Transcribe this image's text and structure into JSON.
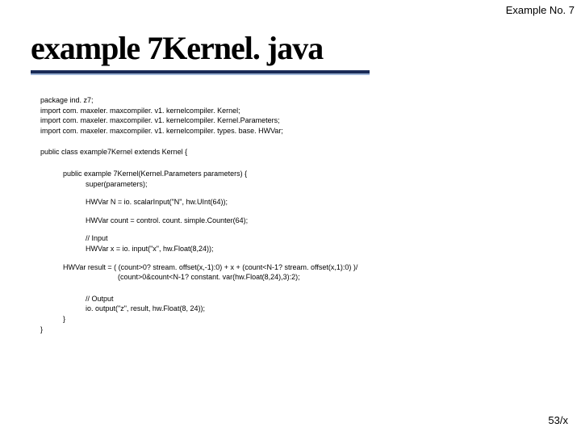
{
  "header": {
    "label": "Example No. 7"
  },
  "title": "example 7Kernel. java",
  "code": {
    "l0": "package ind. z7;",
    "l1": "import com. maxeler. maxcompiler. v1. kernelcompiler. Kernel;",
    "l2": "import com. maxeler. maxcompiler. v1. kernelcompiler. Kernel.Parameters;",
    "l3": "import com. maxeler. maxcompiler. v1. kernelcompiler. types. base. HWVar;",
    "l4": "public class example7Kernel extends Kernel {",
    "l5": "public example 7Kernel(Kernel.Parameters parameters) {",
    "l6": "super(parameters);",
    "l7": "HWVar N = io. scalarInput(\"N\", hw.UInt(64));",
    "l8": "HWVar count = control. count. simple.Counter(64);",
    "l9": "// Input",
    "l10": "HWVar x = io. input(\"x\", hw.Float(8,24));",
    "l11": "HWVar result = ( (count>0? stream. offset(x,-1):0) + x + (count<N-1? stream. offset(x,1):0) )/",
    "l12": "(count>0&count<N-1? constant. var(hw.Float(8,24),3):2);",
    "l13": "// Output",
    "l14": "io. output(\"z\", result, hw.Float(8, 24));",
    "l15": "}",
    "l16": "}"
  },
  "footer": {
    "page": "53/x"
  }
}
